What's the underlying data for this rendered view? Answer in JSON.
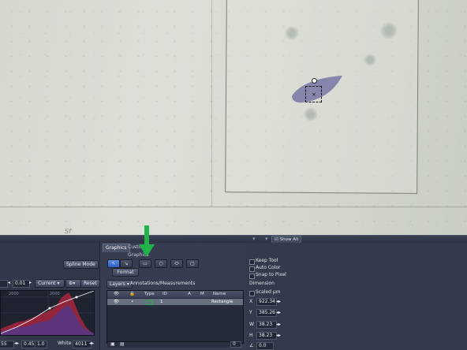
{
  "viewer": {
    "show_all_label": "Show All",
    "marker_label": "Sf"
  },
  "left_panel": {
    "spline_mode_label": "Spline Mode",
    "gamma_step": "0.01",
    "channel_select": "Current",
    "reset_label": "Reset",
    "hist_tick_left": "2000",
    "hist_tick_right": "2000",
    "black_value": "55",
    "gamma_value": "0.45",
    "gamma_max": "1.0",
    "white_label": "White",
    "white_value": "4011"
  },
  "tabs": {
    "graphics": "Graphics",
    "custom": "Custom Graphics"
  },
  "toolbar": {
    "tools": [
      "arrow-select",
      "draw-arrow",
      "rectangle",
      "circle",
      "ellipse",
      "rounded-rectangle"
    ],
    "format_label": "Format"
  },
  "annotations": {
    "layers_label": "Layers",
    "title": "Annotations/Measurements",
    "columns": [
      "Type",
      "ID",
      "A",
      "M",
      "Name"
    ],
    "rows": [
      {
        "id": "1",
        "name": "Rectangle"
      }
    ],
    "footer_count": "0"
  },
  "options": {
    "keep_tool": "Keep Tool",
    "auto_color": "Auto Color",
    "snap_to_pixel": "Snap to Pixel",
    "dimension_title": "Dimension",
    "scaled_um": "Scaled µm",
    "x_label": "X",
    "x_value": "922.34",
    "y_label": "Y",
    "y_value": "385.26",
    "w_label": "W",
    "w_value": "38.23",
    "h_label": "H",
    "h_value": "38.23",
    "angle_value": "0.0"
  },
  "colors": {
    "accent_arrow": "#1fb34a",
    "selected_tool": "#3d6fd6",
    "panel_bg": "#333a4b"
  }
}
